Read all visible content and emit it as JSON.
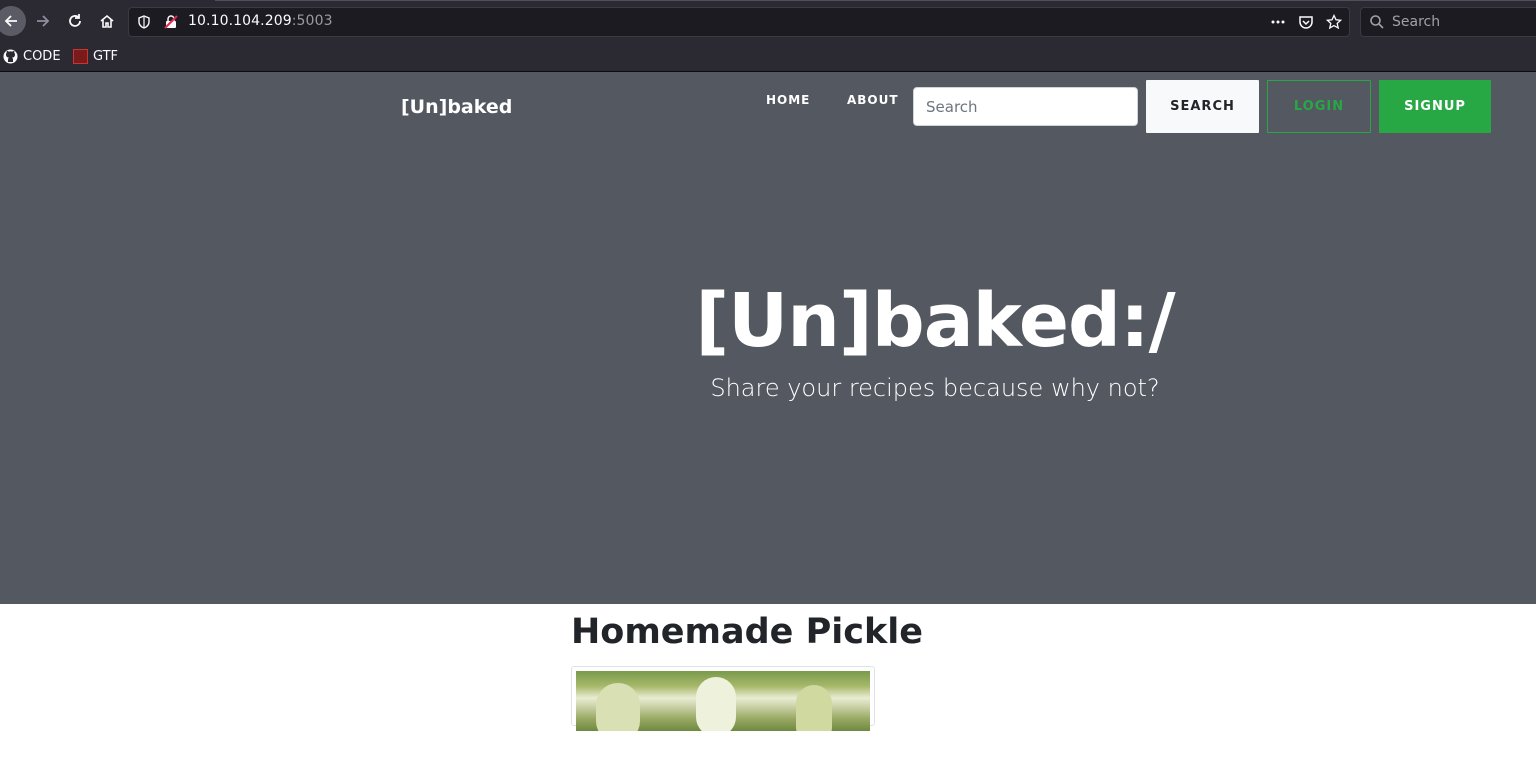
{
  "browser": {
    "url_host": "10.10.104.209",
    "url_port": ":5003",
    "search_placeholder": "Search",
    "bookmarks": [
      {
        "label": "CODE",
        "icon": "github-icon"
      },
      {
        "label": "GTF",
        "icon": "gtf-icon"
      }
    ]
  },
  "nav": {
    "brand": "[Un]baked",
    "home": "HOME",
    "about": "ABOUT",
    "search_placeholder": "Search",
    "search_button": "SEARCH",
    "login_button": "LOGIN",
    "signup_button": "SIGNUP"
  },
  "hero": {
    "title": "[Un]baked:/",
    "subtitle": "Share your recipes because why not?"
  },
  "recipe": {
    "title": "Homemade Pickle"
  },
  "colors": {
    "hero_bg": "#545861",
    "accent_green": "#28a745"
  }
}
